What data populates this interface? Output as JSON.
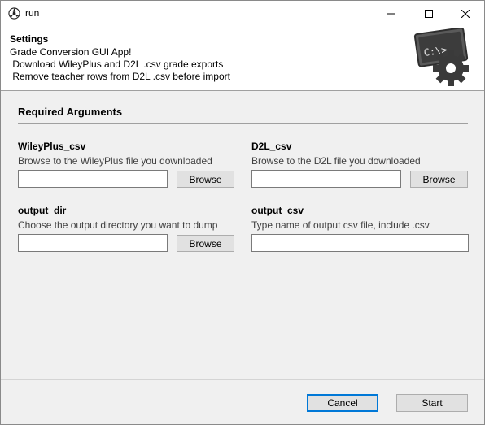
{
  "window": {
    "title": "run"
  },
  "header": {
    "title": "Settings",
    "lines": [
      "Grade Conversion GUI App!",
      " Download WileyPlus and D2L .csv grade exports",
      " Remove teacher rows from D2L .csv before import"
    ],
    "logo_text": "C:\\>_"
  },
  "section": {
    "title": "Required Arguments"
  },
  "fields": [
    {
      "label": "WileyPlus_csv",
      "help": "Browse to the WileyPlus file you downloaded",
      "value": "",
      "button": "Browse"
    },
    {
      "label": "D2L_csv",
      "help": "Browse to the D2L file you downloaded",
      "value": "",
      "button": "Browse"
    },
    {
      "label": "output_dir",
      "help": "Choose the output directory you want to dump",
      "value": "",
      "button": "Browse"
    },
    {
      "label": "output_csv",
      "help": "Type name of output csv file, include .csv",
      "value": ""
    }
  ],
  "footer": {
    "cancel_label": "Cancel",
    "start_label": "Start"
  },
  "colors": {
    "focus_border": "#0078d7",
    "button_face": "#e1e1e1",
    "window_bg": "#f0f0f0"
  },
  "icons": [
    "app-icon",
    "minimize-icon",
    "maximize-icon",
    "close-icon",
    "terminal-gear-logo-icon"
  ]
}
